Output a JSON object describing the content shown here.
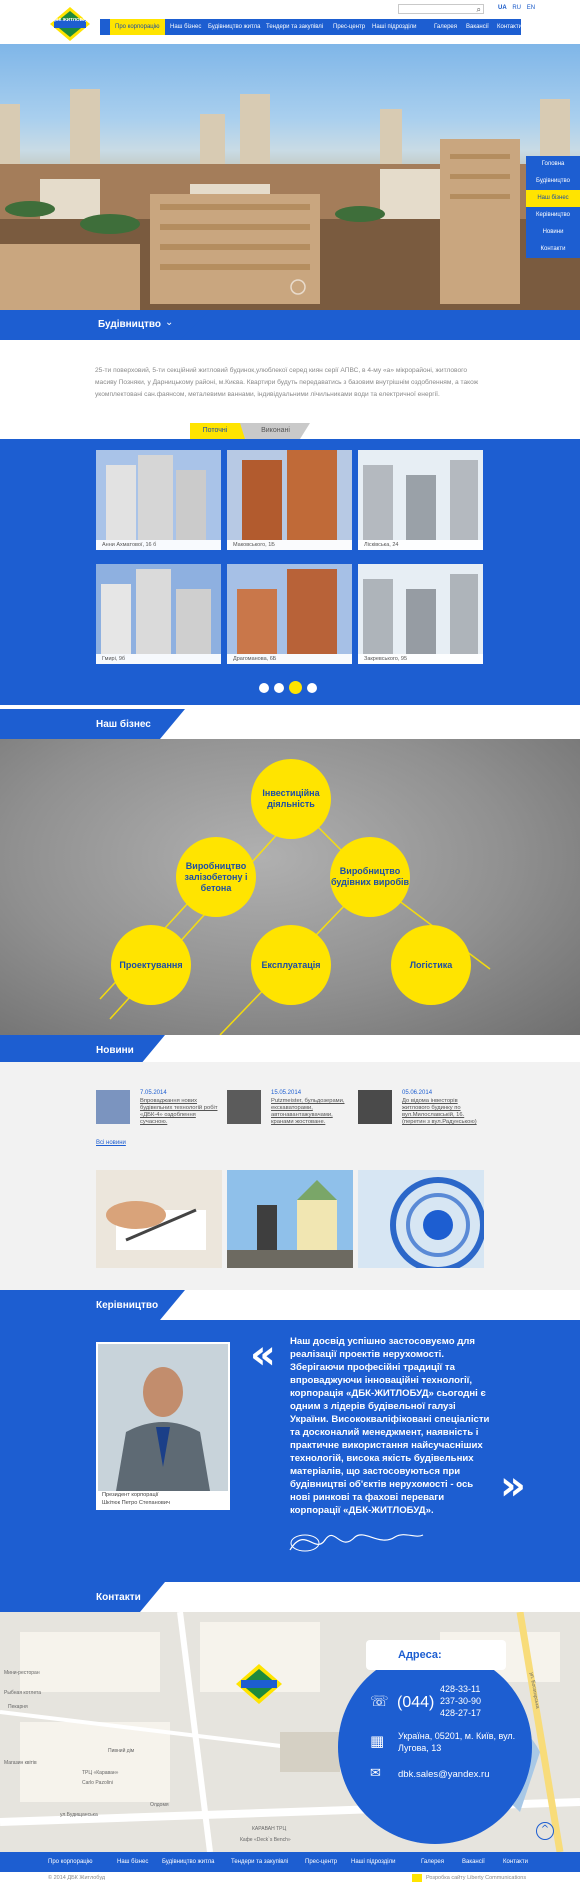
{
  "header": {
    "logo_text": "ДБК ЖИТЛОБУД",
    "search_icon": "magnifier-icon",
    "languages": [
      "UA",
      "RU",
      "EN"
    ],
    "active_language": "UA",
    "nav": [
      "Про корпорацію",
      "Наш бізнес",
      "Будівництво житла",
      "Тендери та закупівлі",
      "Прес-центр",
      "Наші підрозділи",
      "Галерея",
      "Вакансії",
      "Контакти"
    ]
  },
  "hero": {
    "side_menu": [
      "Головна",
      "Будівництво",
      "Наш бізнес",
      "Керівництво",
      "Новини",
      "Контакти"
    ],
    "active_side_index": 2
  },
  "construction": {
    "title": "Будівництво",
    "chevron_icon": "chevron-down-icon",
    "description": "25-ти поверховий, 5-ти секційний житловий будинок,улюблекої серед киян серії АПВС, в 4-му «а» мікрорайоні, житлового масиву Позняки, у Дарницькому районі, м.Києва. Квартири будуть передаватись з базовим внутрішнім оздобленням, а також укомплектовані сан.фаянсом, металевими ваннами, індивідуальними лічильниками води та електричної енергії.",
    "tabs": [
      "Поточні",
      "Виконані"
    ],
    "active_tab": 0,
    "projects": [
      "Анни Ахматової, 16 б",
      "Маковського, 1Б",
      "Лісківська, 24",
      "Гмирі, 9б",
      "Драгоманова, 6Б",
      "Закревського, 95"
    ],
    "pager_count": 4,
    "pager_active": 2
  },
  "business": {
    "title": "Наш бізнес",
    "items": [
      "Інвестиційна діяльність",
      "Виробництво залізобетону і бетона",
      "Виробництво будівних виробів",
      "Проектування",
      "Експлуатація",
      "Логістика"
    ]
  },
  "news": {
    "title": "Новини",
    "items": [
      {
        "date": "7.05.2014",
        "text": "Впроваджання нових будівельних технологій робіт «ДБК-4» оздоблення сучасною."
      },
      {
        "date": "15.05.2014",
        "text": "Putzmeister, бульдозерами, екскаваторами, автонавантажувачами, кранами жостоване."
      },
      {
        "date": "05.06.2014",
        "text": "До відома інвесторів житлового будинку по вул.Милославській, 16. (перетин з вул.Радунською)"
      }
    ],
    "all_news": "Всі новини"
  },
  "management": {
    "title": "Керівництво",
    "caption_role": "Президент корпорації",
    "caption_name": "Шкітюк Петро Степанович",
    "quote": "Наш досвід успішно застосовуємо для реалізації проектів нерухомості. Зберігаючи професійні традиції та впроваджуючи інноваційні технології, корпорація «ДБК-ЖИТЛОБУД» сьогодні є одним з лідерів будівельної галузі України. Висококваліфіковані спеціалісти та досконалий менеджмент, наявність і практичне використання найсучасніших технологій, висока якість будівельних матеріалів, що застосовуються при будівництві об'єктів нерухомості - ось нові ринкові та фахові переваги корпорації «ДБК-ЖИТЛОБУД».",
    "open_quote_icon": "open-quote-icon",
    "close_quote_icon": "close-quote-icon"
  },
  "contacts": {
    "title": "Контакти",
    "address_title": "Адреса:",
    "phone_code": "(044)",
    "phones": [
      "428-33-11",
      "237-30-90",
      "428-27-17"
    ],
    "address": "Україна, 05201, м. Київ, вул. Лугова, 13",
    "email": "dbk.sales@yandex.ru",
    "map_labels": [
      "Мини-ресторан",
      "Рыбная котлета",
      "Пекарня",
      "ул.Будищанська",
      "Магазин квітів",
      "Carlo Pazolini",
      "Пивний дім",
      "КАРАВАН ТРЦ",
      "Кафе «Deck`s Bench»",
      "ул. Богатирська",
      "Олдомя",
      "ТРЦ «Караван»"
    ]
  },
  "footer": {
    "nav": [
      "Про корпорацію",
      "Наш бізнес",
      "Будівництво житла",
      "Тендери та закупівлі",
      "Прес-центр",
      "Наші підрозділи",
      "Галерея",
      "Вакансії",
      "Контакти"
    ],
    "copyright": "© 2014 ДБК Житлобуд",
    "credit": "Розробка сайту Liberty Communications"
  },
  "colors": {
    "blue": "#1d5ed1",
    "yellow": "#ffe400",
    "gray": "#909090"
  }
}
